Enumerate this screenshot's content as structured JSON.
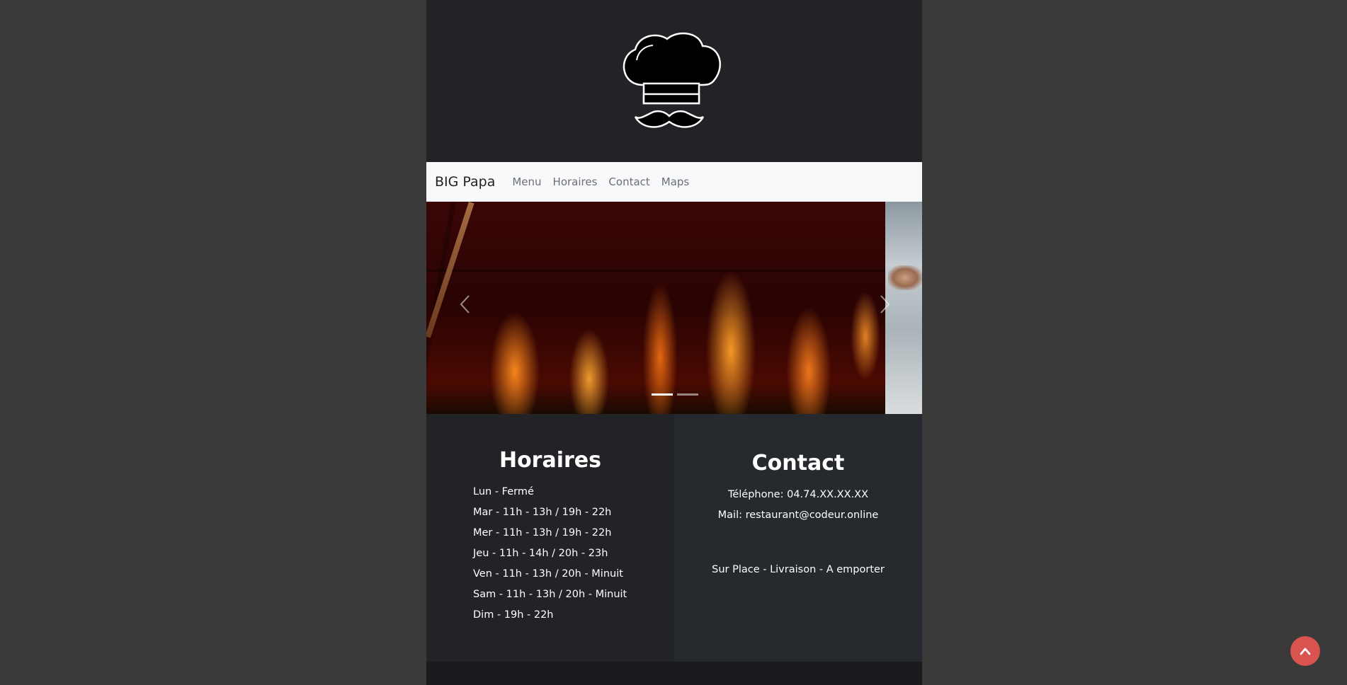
{
  "navbar": {
    "brand": "BIG Papa",
    "links": [
      "Menu",
      "Horaires",
      "Contact",
      "Maps"
    ]
  },
  "carousel": {
    "prev_icon": "chevron-left-icon",
    "next_icon": "chevron-right-icon",
    "slides": 2,
    "active_index": 0
  },
  "hours": {
    "title": "Horaires",
    "items": [
      "Lun - Fermé",
      "Mar - 11h - 13h / 19h - 22h",
      "Mer - 11h - 13h / 19h - 22h",
      "Jeu - 11h - 14h / 20h - 23h",
      "Ven - 11h - 13h / 20h - Minuit",
      "Sam - 11h - 13h / 20h - Minuit",
      "Dim - 19h - 22h"
    ]
  },
  "contact": {
    "title": "Contact",
    "phone": "Téléphone: 04.74.XX.XX.XX",
    "mail": "Mail: restaurant@codeur.online",
    "services": "Sur Place - Livraison - A emporter"
  },
  "colors": {
    "background": "#3a3a3a",
    "page": "#212327",
    "navbar": "#f8f9fa",
    "back_to_top": "#d9534f"
  }
}
